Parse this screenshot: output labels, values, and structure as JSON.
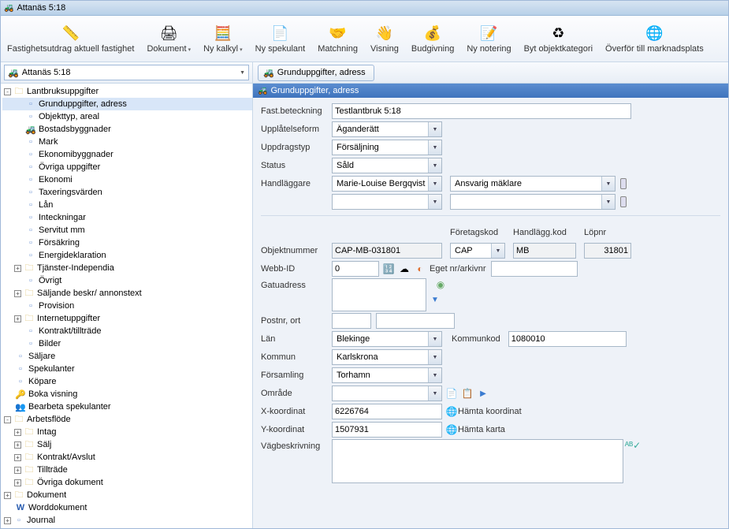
{
  "window_title": "Attanäs 5:18",
  "toolbar": [
    {
      "label": "Fastighetsutdrag aktuell fastighet",
      "icon": "📏",
      "drop": false
    },
    {
      "label": "Dokument",
      "icon": "🖨",
      "drop": true
    },
    {
      "label": "Ny kalkyl",
      "icon": "🧮",
      "drop": true
    },
    {
      "label": "Ny spekulant",
      "icon": "📄",
      "drop": false
    },
    {
      "label": "Matchning",
      "icon": "🤝",
      "drop": false
    },
    {
      "label": "Visning",
      "icon": "👋",
      "drop": false
    },
    {
      "label": "Budgivning",
      "icon": "💰",
      "drop": false
    },
    {
      "label": "Ny notering",
      "icon": "📝",
      "drop": false
    },
    {
      "label": "Byt objektkategori",
      "icon": "♻",
      "drop": false
    },
    {
      "label": "Överför till marknadsplats",
      "icon": "🌐",
      "drop": false
    }
  ],
  "breadcrumb": "Attanäs 5:18",
  "tree": {
    "root": "Lantbruksuppgifter",
    "level2": [
      {
        "label": "Grunduppgifter, adress",
        "icon": "page",
        "sel": true
      },
      {
        "label": "Objekttyp, areal",
        "icon": "page"
      },
      {
        "label": "Bostadsbyggnader",
        "icon": "tractor"
      },
      {
        "label": "Mark",
        "icon": "page"
      },
      {
        "label": "Ekonomibyggnader",
        "icon": "page"
      },
      {
        "label": "Övriga uppgifter",
        "icon": "page"
      },
      {
        "label": "Ekonomi",
        "icon": "page"
      },
      {
        "label": "Taxeringsvärden",
        "icon": "page"
      },
      {
        "label": "Lån",
        "icon": "page"
      },
      {
        "label": "Inteckningar",
        "icon": "page"
      },
      {
        "label": "Servitut mm",
        "icon": "page"
      },
      {
        "label": "Försäkring",
        "icon": "page"
      },
      {
        "label": "Energideklaration",
        "icon": "page"
      },
      {
        "label": "Tjänster-Independia",
        "icon": "folder",
        "expand": "+"
      },
      {
        "label": "Övrigt",
        "icon": "page"
      },
      {
        "label": "Säljande beskr/ annonstext",
        "icon": "folder",
        "expand": "+"
      },
      {
        "label": "Provision",
        "icon": "page"
      },
      {
        "label": "Internetuppgifter",
        "icon": "folder",
        "expand": "+"
      },
      {
        "label": "Kontrakt/tillträde",
        "icon": "page"
      },
      {
        "label": "Bilder",
        "icon": "page"
      }
    ],
    "level1b": [
      {
        "label": "Säljare",
        "icon": "page"
      },
      {
        "label": "Spekulanter",
        "icon": "page"
      },
      {
        "label": "Köpare",
        "icon": "page"
      },
      {
        "label": "Boka visning",
        "icon": "keys"
      },
      {
        "label": "Bearbeta spekulanter",
        "icon": "persons"
      }
    ],
    "workflow_root": "Arbetsflöde",
    "workflow": [
      {
        "label": "Intag",
        "expand": "+"
      },
      {
        "label": "Sälj",
        "expand": "+"
      },
      {
        "label": "Kontrakt/Avslut",
        "expand": "+"
      },
      {
        "label": "Tillträde",
        "expand": "+"
      },
      {
        "label": "Övriga dokument",
        "expand": "+"
      }
    ],
    "bottom": [
      {
        "label": "Dokument",
        "icon": "folder",
        "expand": "+"
      },
      {
        "label": "Worddokument",
        "icon": "word"
      },
      {
        "label": "Journal",
        "icon": "page",
        "expand": "+"
      }
    ]
  },
  "tab_button": "Grunduppgifter, adress",
  "section_header": "Grunduppgifter, adress",
  "form": {
    "fastbeteckning_label": "Fast.beteckning",
    "fastbeteckning": "Testlantbruk 5:18",
    "upplatelseform_label": "Upplåtelseform",
    "upplatelseform": "Äganderätt",
    "uppdragstyp_label": "Uppdragstyp",
    "uppdragstyp": "Försäljning",
    "status_label": "Status",
    "status": "Såld",
    "handlaggare_label": "Handläggare",
    "handlaggare": "Marie-Louise Bergqvist",
    "ansvarig": "Ansvarig mäklare",
    "foretagskod_label": "Företagskod",
    "foretagskod": "CAP",
    "handlaggkod_label": "Handlägg.kod",
    "handlaggkod": "MB",
    "lopnr_label": "Löpnr",
    "lopnr": "31801",
    "objektnummer_label": "Objektnummer",
    "objektnummer": "CAP-MB-031801",
    "webbid_label": "Webb-ID",
    "webbid": "0",
    "egetnr_label": "Eget nr/arkivnr",
    "egetnr": "",
    "gatuadress_label": "Gatuadress",
    "gatuadress": "",
    "postnr_label": "Postnr, ort",
    "lan_label": "Län",
    "lan": "Blekinge",
    "kommunkod_label": "Kommunkod",
    "kommunkod": "1080010",
    "kommun_label": "Kommun",
    "kommun": "Karlskrona",
    "forsamling_label": "Församling",
    "forsamling": "Torhamn",
    "omrade_label": "Område",
    "omrade": "",
    "xkoord_label": "X-koordinat",
    "xkoord": "6226764",
    "hamta_koordinat": "Hämta koordinat",
    "ykoord_label": "Y-koordinat",
    "ykoord": "1507931",
    "hamta_karta": "Hämta karta",
    "vagbeskrivning_label": "Vägbeskrivning",
    "vagbeskrivning": ""
  }
}
